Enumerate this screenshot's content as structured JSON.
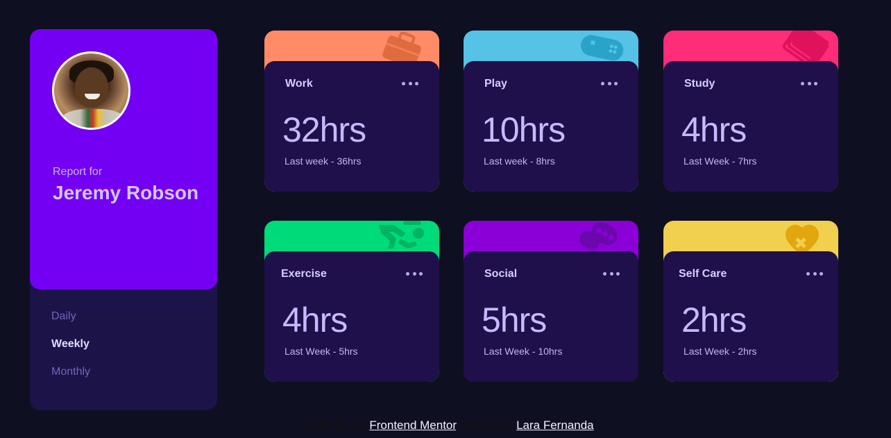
{
  "profile": {
    "report_for": "Report for",
    "name": "Jeremy Robson",
    "avatar_icon": "profile-photo",
    "periods": [
      {
        "label": "Daily",
        "active": false
      },
      {
        "label": "Weekly",
        "active": true
      },
      {
        "label": "Monthly",
        "active": false
      }
    ]
  },
  "cards": [
    {
      "title": "Work",
      "hours": "32hrs",
      "previous": "Last week - 36hrs",
      "color": "#ff8c66",
      "icon": "briefcase-icon"
    },
    {
      "title": "Play",
      "hours": "10hrs",
      "previous": "Last week - 8hrs",
      "color": "#56c2e6",
      "icon": "gamepad-icon"
    },
    {
      "title": "Study",
      "hours": "4hrs",
      "previous": "Last Week - 7hrs",
      "color": "#ff5e7d",
      "icon": "book-icon"
    },
    {
      "title": "Exercise",
      "hours": "4hrs",
      "previous": "Last Week - 5hrs",
      "color": "#4bcf82",
      "icon": "running-icon"
    },
    {
      "title": "Social",
      "hours": "5hrs",
      "previous": "Last Week - 10hrs",
      "color": "#7335d2",
      "icon": "social-icon"
    },
    {
      "title": "Self Care",
      "hours": "2hrs",
      "previous": "Last Week - 2hrs",
      "color": "#f1c75b",
      "icon": "heart-icon"
    }
  ],
  "footer": {
    "prefix": "Challenge by",
    "mentor_link": "Frontend Mentor",
    "middle": ". Coded by",
    "author_link": "Lara Fernanda"
  }
}
